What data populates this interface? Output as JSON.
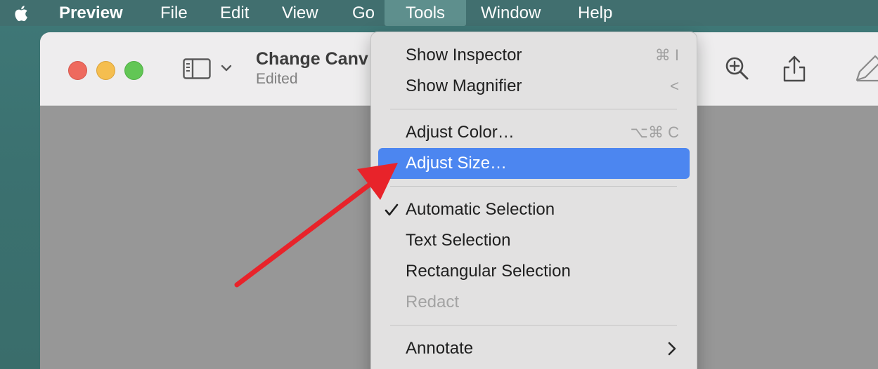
{
  "menubar": {
    "app_name": "Preview",
    "items": [
      "File",
      "Edit",
      "View",
      "Go",
      "Tools",
      "Window",
      "Help"
    ],
    "active_item": "Tools"
  },
  "window": {
    "title": "Change Canv",
    "status": "Edited"
  },
  "tools_menu": {
    "items": [
      {
        "label": "Show Inspector",
        "shortcut": "⌘ I"
      },
      {
        "label": "Show Magnifier",
        "shortcut": "<"
      },
      {
        "label": "Adjust Color…",
        "shortcut": "⌥⌘ C"
      },
      {
        "label": "Adjust Size…",
        "highlighted": true
      },
      {
        "label": "Automatic Selection",
        "checked": true
      },
      {
        "label": "Text Selection"
      },
      {
        "label": "Rectangular Selection"
      },
      {
        "label": "Redact",
        "disabled": true
      },
      {
        "label": "Annotate",
        "submenu": true
      }
    ]
  },
  "colors": {
    "menu_highlight": "#4c86f0",
    "annotation_arrow": "#e8232a",
    "desktop": "#3b7170"
  },
  "icons": [
    "apple-logo-icon",
    "sidebar-toggle-icon",
    "chevron-down-icon",
    "zoom-in-icon",
    "share-icon",
    "markup-pen-icon",
    "checkmark-icon",
    "chevron-right-icon"
  ]
}
